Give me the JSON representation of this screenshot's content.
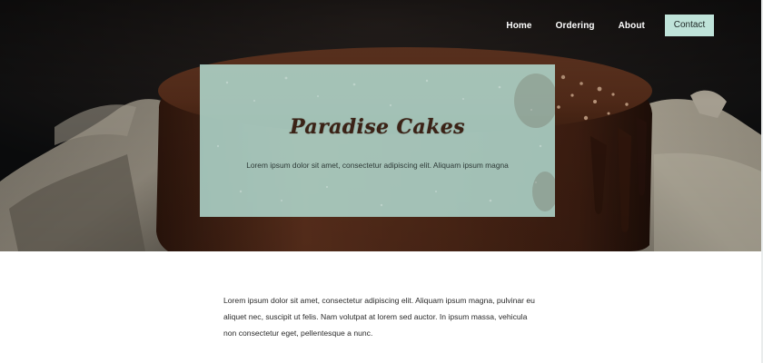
{
  "nav": {
    "items": [
      {
        "label": "Home"
      },
      {
        "label": "Ordering"
      },
      {
        "label": "About"
      }
    ],
    "contact_label": "Contact",
    "contact_color": "#bfe3d9"
  },
  "hero": {
    "title": "Paradise Cakes",
    "tagline": "Lorem ipsum dolor sit amet, consectetur adipiscing elit. Aliquam ipsum magna",
    "card_color": "#b2dbd1"
  },
  "content": {
    "paragraph": "Lorem ipsum dolor sit amet, consectetur adipiscing elit. Aliquam ipsum magna, pulvinar eu aliquet nec, suscipit ut felis. Nam volutpat at lorem sed auctor. In ipsum massa, vehicula non consectetur eget, pellentesque a nunc."
  }
}
